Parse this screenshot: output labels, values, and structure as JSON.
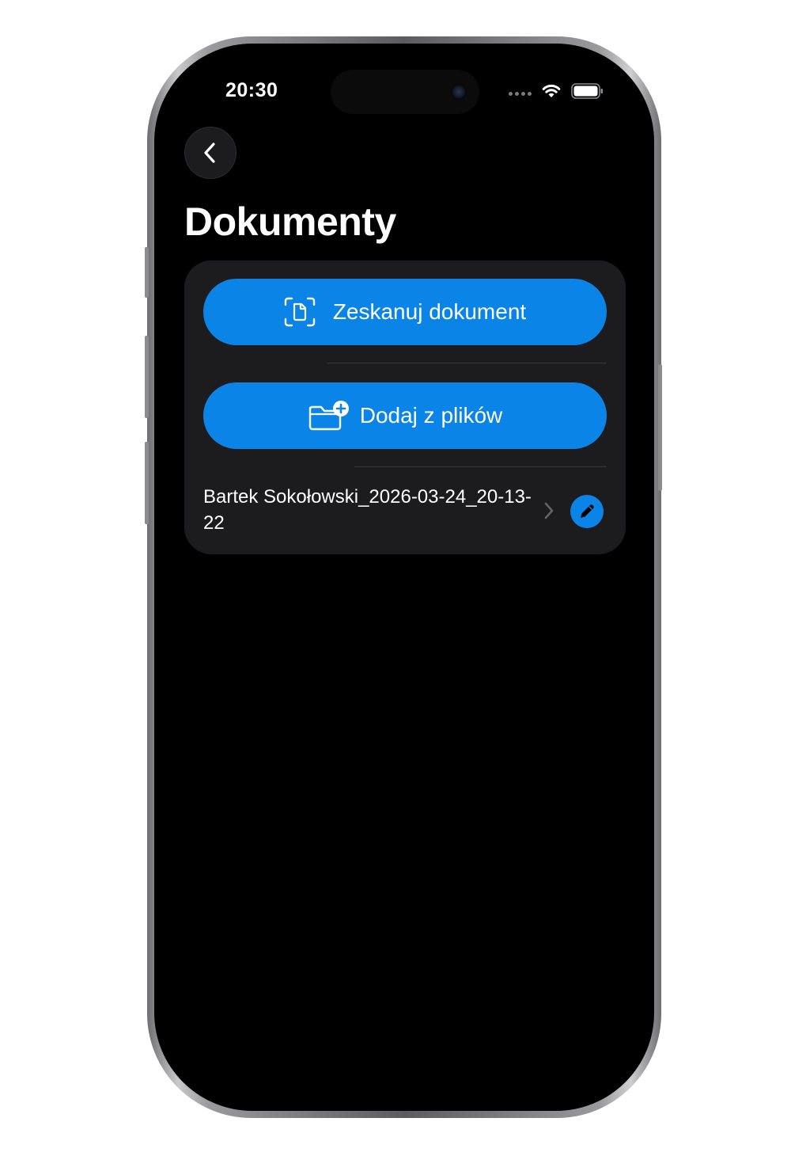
{
  "status_bar": {
    "time": "20:30"
  },
  "nav": {
    "back_icon": "chevron-left-icon"
  },
  "page": {
    "title": "Dokumenty"
  },
  "actions": {
    "scan_label": "Zeskanuj dokument",
    "scan_icon": "document-scanner-icon",
    "files_label": "Dodaj z plików",
    "files_icon": "folder-plus-icon"
  },
  "documents": [
    {
      "name": "Bartek Sokołowski_2026-03-24_20-13-22"
    }
  ],
  "colors": {
    "accent": "#0a84e6",
    "card_background": "#1c1c1e",
    "screen_background": "#000000"
  }
}
